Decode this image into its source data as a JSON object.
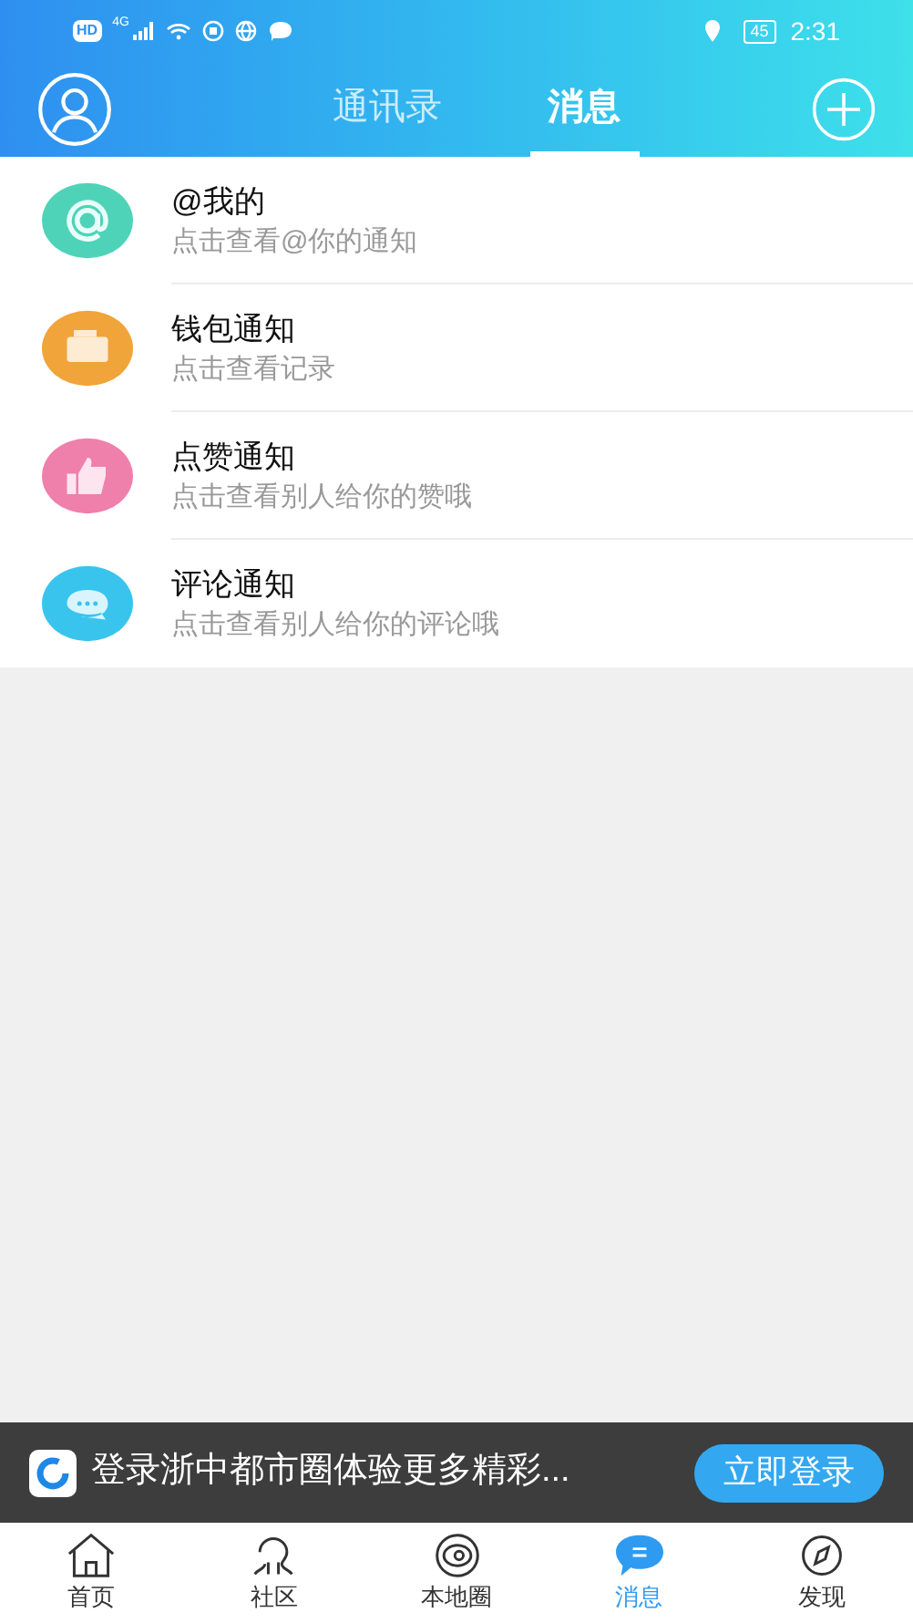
{
  "status_bar": {
    "hd": "HD",
    "network": "4G",
    "battery": "45",
    "time": "2:31"
  },
  "header": {
    "tabs": [
      {
        "label": "通讯录",
        "selected": false
      },
      {
        "label": "消息",
        "selected": true
      }
    ]
  },
  "notifications": [
    {
      "kind": "at",
      "color": "#4fd3b8",
      "title": "@我的",
      "subtitle": "点击查看@你的通知"
    },
    {
      "kind": "wallet",
      "color": "#f0a43a",
      "title": "钱包通知",
      "subtitle": "点击查看记录"
    },
    {
      "kind": "like",
      "color": "#ef7fab",
      "title": "点赞通知",
      "subtitle": "点击查看别人给你的赞哦"
    },
    {
      "kind": "comment",
      "color": "#39c4ee",
      "title": "评论通知",
      "subtitle": "点击查看别人给你的评论哦"
    }
  ],
  "login_banner": {
    "text": "登录浙中都市圈体验更多精彩...",
    "button": "立即登录"
  },
  "bottom_nav": [
    {
      "kind": "home",
      "label": "首页",
      "selected": false
    },
    {
      "kind": "community",
      "label": "社区",
      "selected": false
    },
    {
      "kind": "local",
      "label": "本地圈",
      "selected": false
    },
    {
      "kind": "messages",
      "label": "消息",
      "selected": true
    },
    {
      "kind": "discover",
      "label": "发现",
      "selected": false
    }
  ]
}
